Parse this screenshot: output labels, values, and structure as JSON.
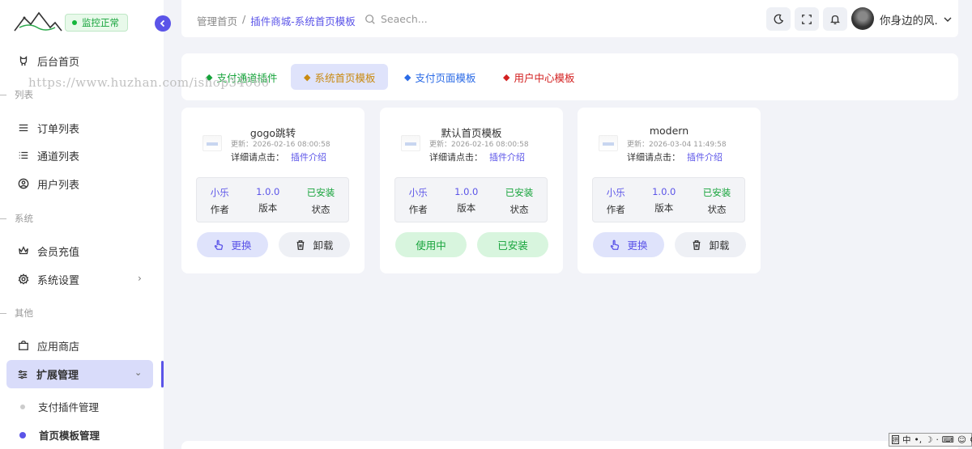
{
  "sidebar": {
    "status": "监控正常",
    "home": "后台首页",
    "sections": {
      "list": "列表",
      "system": "系统",
      "other": "其他"
    },
    "items": {
      "orders": "订单列表",
      "channels": "通道列表",
      "users": "用户列表",
      "recharge": "会员充值",
      "settings": "系统设置",
      "store": "应用商店",
      "extension": "扩展管理",
      "pay_plugins": "支付插件管理",
      "home_templates": "首页模板管理"
    }
  },
  "watermark": "https://www.huzhan.com/ishop34060",
  "header": {
    "breadcrumb_home": "管理首页",
    "breadcrumb_sep": "/",
    "breadcrumb_current": "插件商城-系统首页模板",
    "search_placeholder": "Seaech...",
    "user_name": "你身边的风."
  },
  "tabs": [
    {
      "label": "支付通道插件",
      "color": "#15a33a"
    },
    {
      "label": "系统首页模板",
      "color": "#c98a10"
    },
    {
      "label": "支付页面模板",
      "color": "#2b6be6"
    },
    {
      "label": "用户中心模板",
      "color": "#d32020"
    }
  ],
  "cards": [
    {
      "title": "gogo跳转",
      "updated": "更新：2026-02-16 08:00:58",
      "detail_label": "详细请点击：",
      "detail_link": "插件介绍",
      "author": "小乐",
      "author_label": "作者",
      "version": "1.0.0",
      "version_label": "版本",
      "state": "已安装",
      "state_label": "状态",
      "btn1": "更换",
      "btn2": "卸载"
    },
    {
      "title": "默认首页模板",
      "updated": "更新：2026-02-16 08:00:58",
      "detail_label": "详细请点击：",
      "detail_link": "插件介绍",
      "author": "小乐",
      "author_label": "作者",
      "version": "1.0.0",
      "version_label": "版本",
      "state": "已安装",
      "state_label": "状态",
      "btn1": "使用中",
      "btn2": "已安装"
    },
    {
      "title": "modern",
      "updated": "更新：2026-03-04 11:49:58",
      "detail_label": "详细请点击：",
      "detail_link": "插件介绍",
      "author": "小乐",
      "author_label": "作者",
      "version": "1.0.0",
      "version_label": "版本",
      "state": "已安装",
      "state_label": "状态",
      "btn1": "更换",
      "btn2": "卸载"
    }
  ],
  "ime": {
    "mode": "中"
  }
}
